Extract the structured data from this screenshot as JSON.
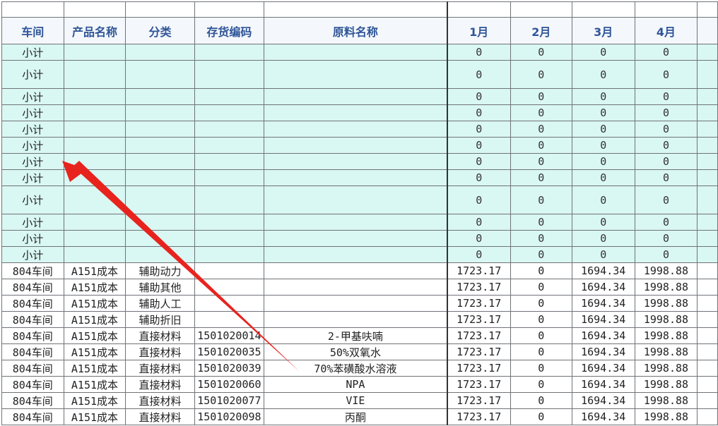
{
  "headers": [
    "车间",
    "产品名称",
    "分类",
    "存货编码",
    "原料名称",
    "1月",
    "2月",
    "3月",
    "4月"
  ],
  "subtotal_rows": [
    {
      "label": "小计",
      "values": [
        "0",
        "0",
        "0",
        "0"
      ],
      "tall": false
    },
    {
      "label": "小计",
      "values": [
        "0",
        "0",
        "0",
        "0"
      ],
      "tall": true
    },
    {
      "label": "小计",
      "values": [
        "0",
        "0",
        "0",
        "0"
      ],
      "tall": false
    },
    {
      "label": "小计",
      "values": [
        "0",
        "0",
        "0",
        "0"
      ],
      "tall": false
    },
    {
      "label": "小计",
      "values": [
        "0",
        "0",
        "0",
        "0"
      ],
      "tall": false
    },
    {
      "label": "小计",
      "values": [
        "0",
        "0",
        "0",
        "0"
      ],
      "tall": false
    },
    {
      "label": "小计",
      "values": [
        "0",
        "0",
        "0",
        "0"
      ],
      "tall": false
    },
    {
      "label": "小计",
      "values": [
        "0",
        "0",
        "0",
        "0"
      ],
      "tall": false
    },
    {
      "label": "小计",
      "values": [
        "0",
        "0",
        "0",
        "0"
      ],
      "tall": true
    },
    {
      "label": "小计",
      "values": [
        "0",
        "0",
        "0",
        "0"
      ],
      "tall": false
    },
    {
      "label": "小计",
      "values": [
        "0",
        "0",
        "0",
        "0"
      ],
      "tall": false
    },
    {
      "label": "小计",
      "values": [
        "0",
        "0",
        "0",
        "0"
      ],
      "tall": false
    }
  ],
  "data_rows": [
    {
      "workshop": "804车间",
      "product": "A151成本",
      "category": "辅助动力",
      "code": "",
      "material": "",
      "m1": "1723.17",
      "m2": "0",
      "m3": "1694.34",
      "m4": "1998.88"
    },
    {
      "workshop": "804车间",
      "product": "A151成本",
      "category": "辅助其他",
      "code": "",
      "material": "",
      "m1": "1723.17",
      "m2": "0",
      "m3": "1694.34",
      "m4": "1998.88"
    },
    {
      "workshop": "804车间",
      "product": "A151成本",
      "category": "辅助人工",
      "code": "",
      "material": "",
      "m1": "1723.17",
      "m2": "0",
      "m3": "1694.34",
      "m4": "1998.88"
    },
    {
      "workshop": "804车间",
      "product": "A151成本",
      "category": "辅助折旧",
      "code": "",
      "material": "",
      "m1": "1723.17",
      "m2": "0",
      "m3": "1694.34",
      "m4": "1998.88"
    },
    {
      "workshop": "804车间",
      "product": "A151成本",
      "category": "直接材料",
      "code": "1501020014",
      "material": "2-甲基呋喃",
      "m1": "1723.17",
      "m2": "0",
      "m3": "1694.34",
      "m4": "1998.88"
    },
    {
      "workshop": "804车间",
      "product": "A151成本",
      "category": "直接材料",
      "code": "1501020035",
      "material": "50%双氧水",
      "m1": "1723.17",
      "m2": "0",
      "m3": "1694.34",
      "m4": "1998.88"
    },
    {
      "workshop": "804车间",
      "product": "A151成本",
      "category": "直接材料",
      "code": "1501020039",
      "material": "70%苯磺酸水溶液",
      "m1": "1723.17",
      "m2": "0",
      "m3": "1694.34",
      "m4": "1998.88"
    },
    {
      "workshop": "804车间",
      "product": "A151成本",
      "category": "直接材料",
      "code": "1501020060",
      "material": "NPA",
      "m1": "1723.17",
      "m2": "0",
      "m3": "1694.34",
      "m4": "1998.88"
    },
    {
      "workshop": "804车间",
      "product": "A151成本",
      "category": "直接材料",
      "code": "1501020077",
      "material": "VIE",
      "m1": "1723.17",
      "m2": "0",
      "m3": "1694.34",
      "m4": "1998.88"
    },
    {
      "workshop": "804车间",
      "product": "A151成本",
      "category": "直接材料",
      "code": "1501020098",
      "material": "丙酮",
      "m1": "1723.17",
      "m2": "0",
      "m3": "1694.34",
      "m4": "1998.88"
    }
  ],
  "annotation": {
    "arrow_color": "#e8231e"
  },
  "colors": {
    "subtotal_bg": "#d9f7f3",
    "header_text": "#2f5597",
    "grid": "#6f7378"
  }
}
